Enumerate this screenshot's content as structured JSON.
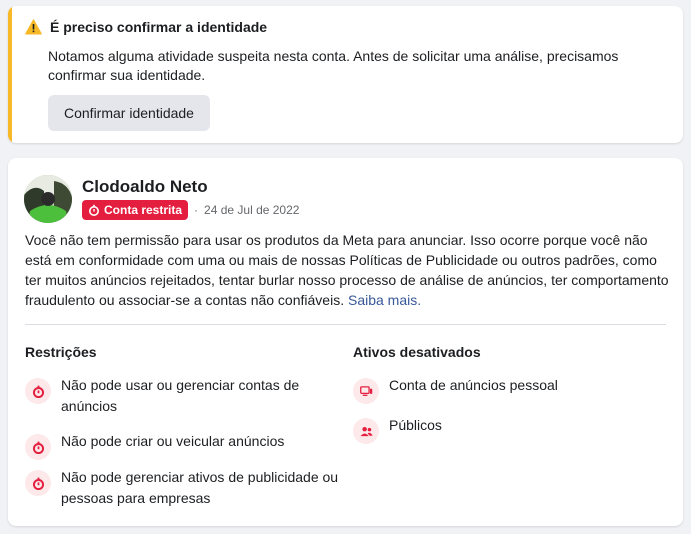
{
  "warning": {
    "title": "É preciso confirmar a identidade",
    "message": "Notamos alguma atividade suspeita nesta conta. Antes de solicitar uma análise, precisamos confirmar sua identidade.",
    "button_label": "Confirmar identidade",
    "accent_color": "#f7b928"
  },
  "account": {
    "name": "Clodoaldo Neto",
    "badge_label": "Conta restrita",
    "badge_color": "#e41e3f",
    "separator": "·",
    "date": "24 de Jul de 2022",
    "description": "Você não tem permissão para usar os produtos da Meta para anunciar. Isso ocorre porque você não está em conformidade com uma ou mais de nossas Políticas de Publicidade ou outros padrões, como ter muitos anúncios rejeitados, tentar burlar nosso processo de análise de anúncios, ter comportamento fraudulento ou associar-se a contas não confiáveis.",
    "learn_more": "Saiba mais."
  },
  "restrictions": {
    "title": "Restrições",
    "items": [
      {
        "label": "Não pode usar ou gerenciar contas de anúncios",
        "icon": "restricted-icon"
      },
      {
        "label": "Não pode criar ou veicular anúncios",
        "icon": "restricted-icon"
      },
      {
        "label": "Não pode gerenciar ativos de publicidade ou pessoas para empresas",
        "icon": "restricted-icon"
      }
    ]
  },
  "disabled_assets": {
    "title": "Ativos desativados",
    "items": [
      {
        "label": "Conta de anúncios pessoal",
        "icon": "ad-account-icon"
      },
      {
        "label": "Públicos",
        "icon": "audiences-icon"
      }
    ]
  }
}
